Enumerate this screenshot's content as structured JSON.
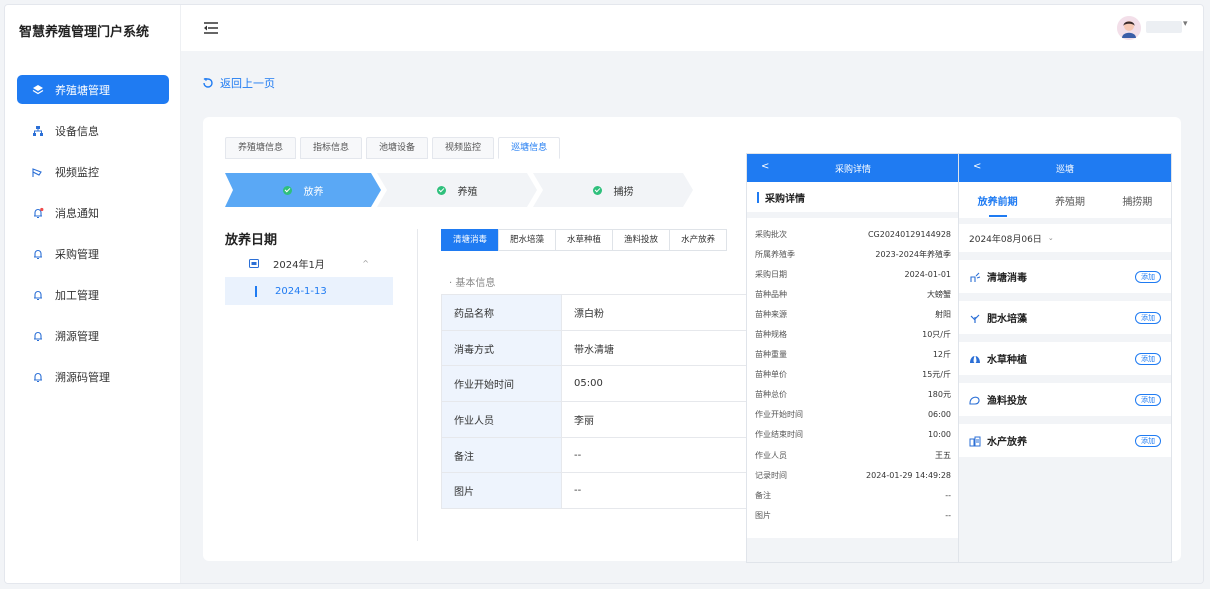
{
  "app": {
    "title": "智慧养殖管理门户系统"
  },
  "sidebar": {
    "items": [
      {
        "label": "养殖塘管理",
        "icon": "layers-icon",
        "active": true
      },
      {
        "label": "设备信息",
        "icon": "network-icon",
        "active": false
      },
      {
        "label": "视频监控",
        "icon": "camera-icon",
        "active": false
      },
      {
        "label": "消息通知",
        "icon": "bell-dot-icon",
        "active": false
      },
      {
        "label": "采购管理",
        "icon": "bell-icon",
        "active": false
      },
      {
        "label": "加工管理",
        "icon": "bell-icon",
        "active": false
      },
      {
        "label": "溯源管理",
        "icon": "bell-icon",
        "active": false
      },
      {
        "label": "溯源码管理",
        "icon": "bell-icon",
        "active": false
      }
    ]
  },
  "header": {
    "menu_icon": "menu-fold-icon",
    "avatar": "avatar",
    "caret": "▾"
  },
  "main": {
    "back_label": "返回上一页",
    "tabs": [
      "养殖塘信息",
      "指标信息",
      "池塘设备",
      "视频监控",
      "巡塘信息"
    ],
    "active_tab": 4,
    "steps": [
      "放养",
      "养殖",
      "捕捞"
    ],
    "date_section": {
      "title": "放养日期",
      "year_label": "2024年1月",
      "year_caret": "^",
      "date_item": "2024-1-13"
    },
    "subtabs": [
      "清塘消毒",
      "肥水培藻",
      "水草种植",
      "渔料投放",
      "水产放养"
    ],
    "active_subtab": 0,
    "info_label": "· 基本信息",
    "info_rows": [
      {
        "key": "药品名称",
        "value": "漂白粉"
      },
      {
        "key": "消毒方式",
        "value": "带水清塘"
      },
      {
        "key": "作业开始时间",
        "value": "05:00"
      },
      {
        "key": "作业人员",
        "value": "李丽"
      },
      {
        "key": "备注",
        "value": "--"
      },
      {
        "key": "图片",
        "value": "--"
      }
    ]
  },
  "purchase_panel": {
    "back": "<",
    "header": "采购详情",
    "section_title": "采购详情",
    "rows": [
      {
        "key": "采购批次",
        "value": "CG20240129144928"
      },
      {
        "key": "所属养殖季",
        "value": "2023-2024年养殖季"
      },
      {
        "key": "采购日期",
        "value": "2024-01-01"
      },
      {
        "key": "苗种品种",
        "value": "大螃蟹"
      },
      {
        "key": "苗种来源",
        "value": "射阳"
      },
      {
        "key": "苗种规格",
        "value": "10只/斤"
      },
      {
        "key": "苗种重量",
        "value": "12斤"
      },
      {
        "key": "苗种单价",
        "value": "15元/斤"
      },
      {
        "key": "苗种总价",
        "value": "180元"
      },
      {
        "key": "作业开始时间",
        "value": "06:00"
      },
      {
        "key": "作业结束时间",
        "value": "10:00"
      },
      {
        "key": "作业人员",
        "value": "王五"
      },
      {
        "key": "记录时间",
        "value": "2024-01-29 14:49:28"
      },
      {
        "key": "备注",
        "value": "--"
      },
      {
        "key": "图片",
        "value": "--"
      }
    ]
  },
  "patrol_panel": {
    "back": "<",
    "header": "巡塘",
    "tabs": [
      "放养前期",
      "养殖期",
      "捕捞期"
    ],
    "active_tab": 0,
    "date": "2024年08月06日",
    "date_caret": "⌄",
    "add_label": "添加",
    "items": [
      {
        "label": "清塘消毒",
        "icon": "disinfect-icon"
      },
      {
        "label": "肥水培藻",
        "icon": "algae-icon"
      },
      {
        "label": "水草种植",
        "icon": "grass-icon"
      },
      {
        "label": "渔料投放",
        "icon": "feed-icon"
      },
      {
        "label": "水产放养",
        "icon": "release-icon"
      }
    ]
  },
  "colors": {
    "primary": "#1f7bf2",
    "step_done": "#2fc07c",
    "bg": "#f2f4f7"
  }
}
